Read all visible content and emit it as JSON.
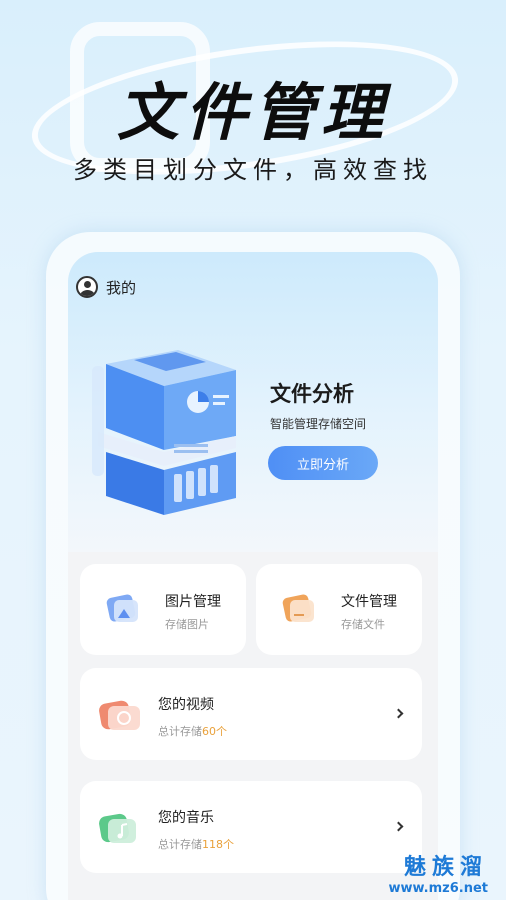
{
  "hero": {
    "title": "文件管理",
    "subtitle": "多类目划分文件，高效查找"
  },
  "profile": {
    "icon": "user-icon",
    "label": "我的"
  },
  "analysis": {
    "title": "文件分析",
    "description": "智能管理存储空间",
    "button_label": "立即分析"
  },
  "tiles": [
    {
      "title": "图片管理",
      "subtitle": "存储图片",
      "icon": "image-folder-icon"
    },
    {
      "title": "文件管理",
      "subtitle": "存储文件",
      "icon": "file-folder-icon"
    }
  ],
  "list": [
    {
      "title": "您的视频",
      "prefix": "总计存储",
      "count": "60个",
      "icon": "camera-icon"
    },
    {
      "title": "您的音乐",
      "prefix": "总计存储",
      "count": "118个",
      "icon": "music-note-icon"
    }
  ],
  "watermark": {
    "name": "魅族溜",
    "url": "www.mz6.net"
  },
  "colors": {
    "accent": "#4f8ff5",
    "count_highlight": "#e9a13b",
    "watermark": "#1e7ad6"
  }
}
